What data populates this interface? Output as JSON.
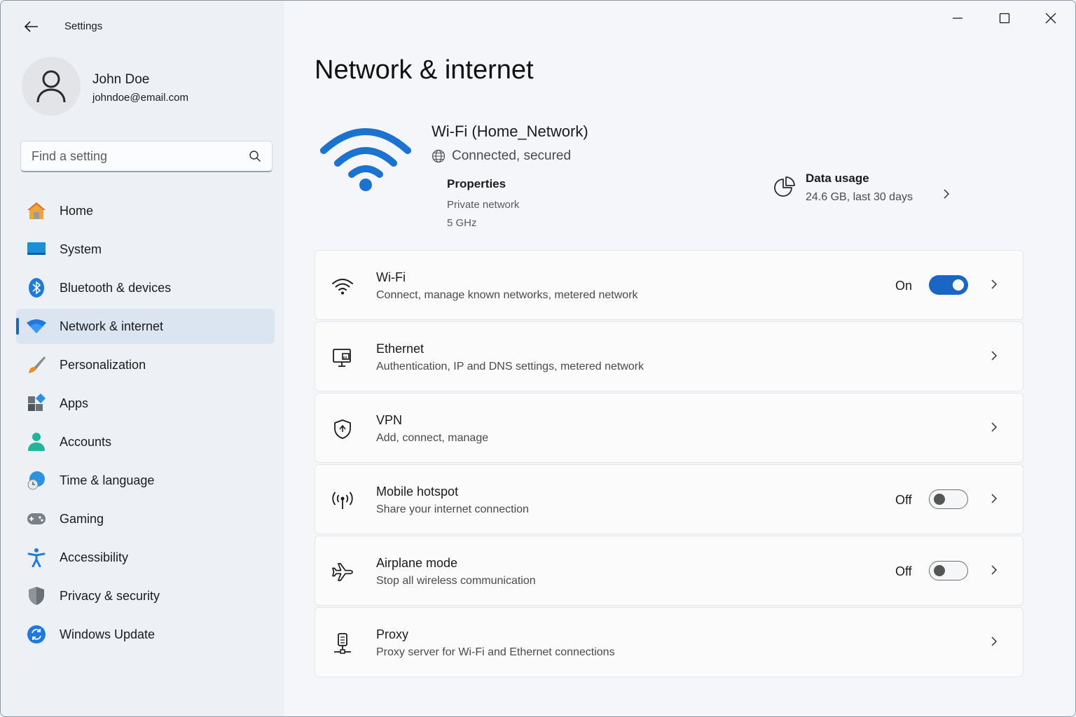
{
  "titlebar": {
    "app_title": "Settings",
    "back_icon": "back-arrow-icon",
    "controls": [
      "minimize-icon",
      "maximize-icon",
      "close-icon"
    ]
  },
  "profile": {
    "name": "John Doe",
    "email": "johndoe@email.com",
    "avatar_icon": "person-icon"
  },
  "search": {
    "placeholder": "Find a setting",
    "icon": "search-icon"
  },
  "sidebar": {
    "items": [
      {
        "label": "Home",
        "icon": "home-icon",
        "active": false
      },
      {
        "label": "System",
        "icon": "system-monitor-icon",
        "active": false
      },
      {
        "label": "Bluetooth & devices",
        "icon": "bluetooth-icon",
        "active": false
      },
      {
        "label": "Network & internet",
        "icon": "wifi-icon",
        "active": true
      },
      {
        "label": "Personalization",
        "icon": "paintbrush-icon",
        "active": false
      },
      {
        "label": "Apps",
        "icon": "apps-icon",
        "active": false
      },
      {
        "label": "Accounts",
        "icon": "person-icon",
        "active": false
      },
      {
        "label": "Time & language",
        "icon": "globe-clock-icon",
        "active": false
      },
      {
        "label": "Gaming",
        "icon": "gamepad-icon",
        "active": false
      },
      {
        "label": "Accessibility",
        "icon": "accessibility-icon",
        "active": false
      },
      {
        "label": "Privacy & security",
        "icon": "shield-icon",
        "active": false
      },
      {
        "label": "Windows Update",
        "icon": "update-icon",
        "active": false
      }
    ]
  },
  "main": {
    "title": "Network & internet",
    "network": {
      "name": "Wi-Fi (Home_Network)",
      "status": "Connected, secured",
      "properties_title": "Properties",
      "properties_line1": "Private network",
      "properties_line2": "5 GHz"
    },
    "data_usage": {
      "title": "Data usage",
      "subtitle": "24.6 GB, last 30 days"
    },
    "cards": [
      {
        "title": "Wi-Fi",
        "subtitle": "Connect, manage known networks, metered network",
        "icon": "wifi-icon",
        "state": "On",
        "toggle": "on"
      },
      {
        "title": "Ethernet",
        "subtitle": "Authentication, IP and DNS settings, metered network",
        "icon": "ethernet-icon",
        "state": "",
        "toggle": null
      },
      {
        "title": "VPN",
        "subtitle": "Add, connect, manage",
        "icon": "vpn-shield-icon",
        "state": "",
        "toggle": null
      },
      {
        "title": "Mobile hotspot",
        "subtitle": "Share your internet connection",
        "icon": "hotspot-icon",
        "state": "Off",
        "toggle": "off"
      },
      {
        "title": "Airplane mode",
        "subtitle": "Stop all wireless communication",
        "icon": "airplane-icon",
        "state": "Off",
        "toggle": "off"
      },
      {
        "title": "Proxy",
        "subtitle": "Proxy server for Wi-Fi and Ethernet connections",
        "icon": "proxy-icon",
        "state": "",
        "toggle": null
      }
    ]
  },
  "colors": {
    "accent": "#1a66c5",
    "sidebar_bg": "#edf1f5",
    "main_bg": "#f4f6f9",
    "card_bg": "#fbfbfc"
  }
}
